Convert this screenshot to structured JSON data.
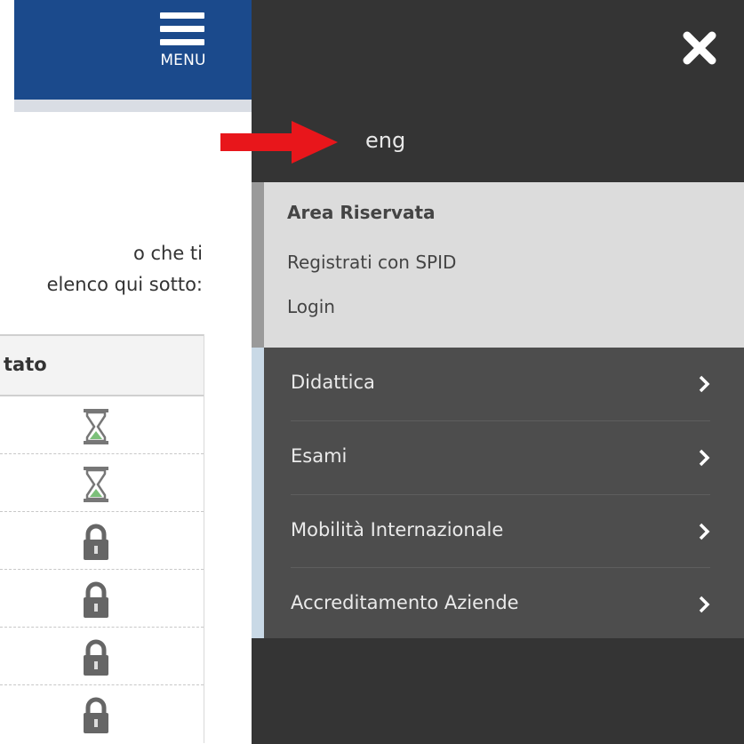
{
  "header": {
    "menu_label": "MENU"
  },
  "page": {
    "intro_line1": "o che ti",
    "intro_line2": "elenco qui sotto:",
    "table": {
      "column_header": "tato",
      "rows": [
        {
          "status_icon": "hourglass-icon"
        },
        {
          "status_icon": "hourglass-icon"
        },
        {
          "status_icon": "lock-icon"
        },
        {
          "status_icon": "lock-icon"
        },
        {
          "status_icon": "lock-icon"
        },
        {
          "status_icon": "lock-icon"
        }
      ]
    }
  },
  "drawer": {
    "close_icon": "close-icon",
    "language_link": "eng",
    "reserved_area": {
      "title": "Area Riservata",
      "items": [
        "Registrati con SPID",
        "Login"
      ]
    },
    "nav": [
      {
        "label": "Didattica",
        "icon": "chevron-right-icon"
      },
      {
        "label": "Esami",
        "icon": "chevron-right-icon"
      },
      {
        "label": "Mobilità Internazionale",
        "icon": "chevron-right-icon"
      },
      {
        "label": "Accreditamento Aziende",
        "icon": "chevron-right-icon"
      }
    ]
  },
  "colors": {
    "header_blue": "#1b4a8c",
    "drawer_dark": "#343434",
    "nav_gray": "#4d4d4d",
    "area_light": "#dcdcdc",
    "arrow_red": "#e8161b",
    "hourglass_green": "#7cc07a"
  }
}
